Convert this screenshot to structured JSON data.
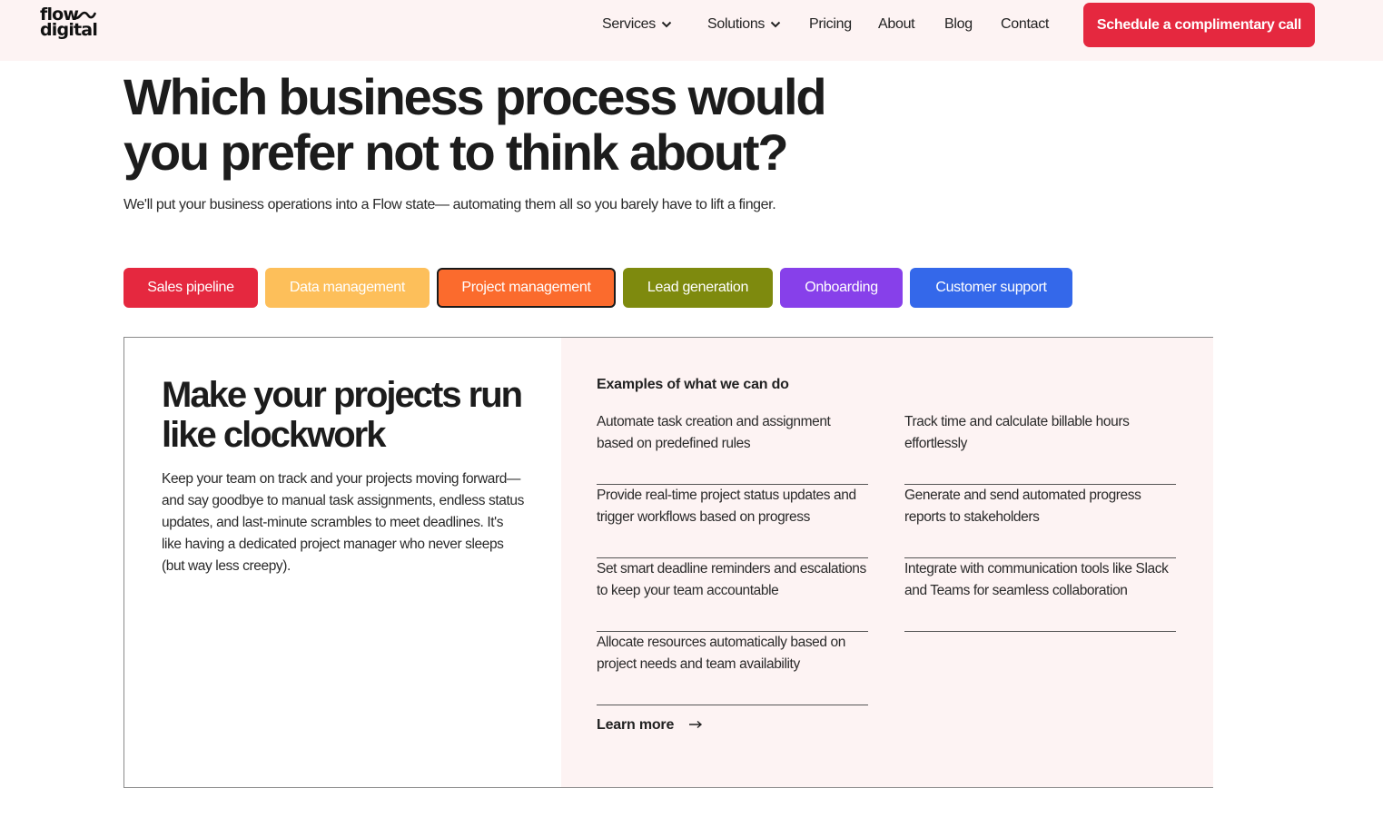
{
  "header": {
    "logo_line1": "flow",
    "logo_line2": "digital",
    "nav": {
      "services": "Services",
      "solutions": "Solutions",
      "pricing": "Pricing",
      "about": "About",
      "blog": "Blog",
      "contact": "Contact"
    },
    "cta": "Schedule a complimentary call"
  },
  "hero": {
    "title": "Which business process would you prefer not to think about?",
    "subtitle": "We'll put your business operations into a Flow state— automating them all so you barely have to lift a finger."
  },
  "tabs": [
    {
      "label": "Sales pipeline",
      "color": "#e5283f"
    },
    {
      "label": "Data management",
      "color": "#fdbf5a"
    },
    {
      "label": "Project management",
      "color": "#fb6b2d"
    },
    {
      "label": "Lead generation",
      "color": "#7e8a0e"
    },
    {
      "label": "Onboarding",
      "color": "#8740ea"
    },
    {
      "label": "Customer support",
      "color": "#3468ea"
    }
  ],
  "active_tab": "Project management",
  "panel": {
    "title": "Make your projects run like clockwork",
    "body": "Keep your team on track and your projects moving forward—and say goodbye to manual task assignments, endless status updates, and last-minute scrambles to meet deadlines. It's like having a dedicated project manager who never sleeps (but way less creepy).",
    "examples_heading": "Examples of what we can do",
    "examples": [
      "Automate task creation and assignment based on predefined rules",
      "Track time and calculate billable hours effortlessly",
      "Provide real-time project status updates and trigger workflows based on progress",
      "Generate and send automated progress reports to stakeholders",
      "Set smart deadline reminders and escalations to keep your team accountable",
      "Integrate with communication tools like Slack and Teams for seamless collaboration",
      "Allocate resources automatically based on project needs and team availability"
    ],
    "learn_more": "Learn more"
  }
}
